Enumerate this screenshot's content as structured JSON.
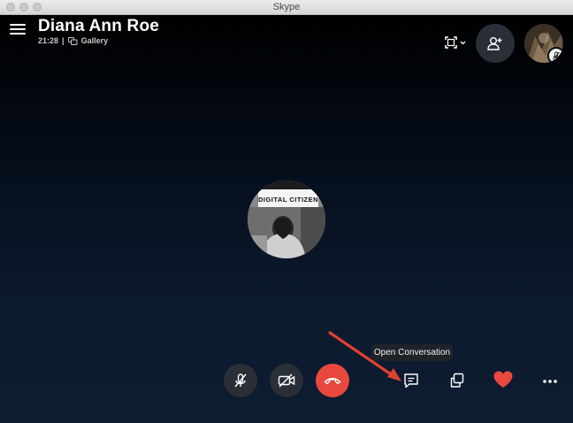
{
  "window": {
    "title": "Skype"
  },
  "call": {
    "caller_name": "Diana Ann Roe",
    "duration": "21:28",
    "separator": "|",
    "view_mode": "Gallery"
  },
  "center_avatar": {
    "caption": "DIGITAL CITIZEN"
  },
  "tooltip": {
    "text": "Open Conversation"
  },
  "icons": {
    "menu": "hamburger-menu-icon",
    "gallery": "gallery-icon",
    "fullscreen": "fullscreen-icon",
    "add_person": "add-person-icon",
    "mic_muted": "mic-off-icon",
    "video_off": "video-off-icon",
    "end_call": "end-call-icon",
    "chat": "chat-icon",
    "pip": "picture-in-picture-icon",
    "heart": "heart-icon",
    "more": "more-options-icon"
  },
  "colors": {
    "end_call": "#e8483d",
    "heart": "#e8483d",
    "button_bg": "#2a2f37",
    "annotation_arrow": "#e04130"
  }
}
